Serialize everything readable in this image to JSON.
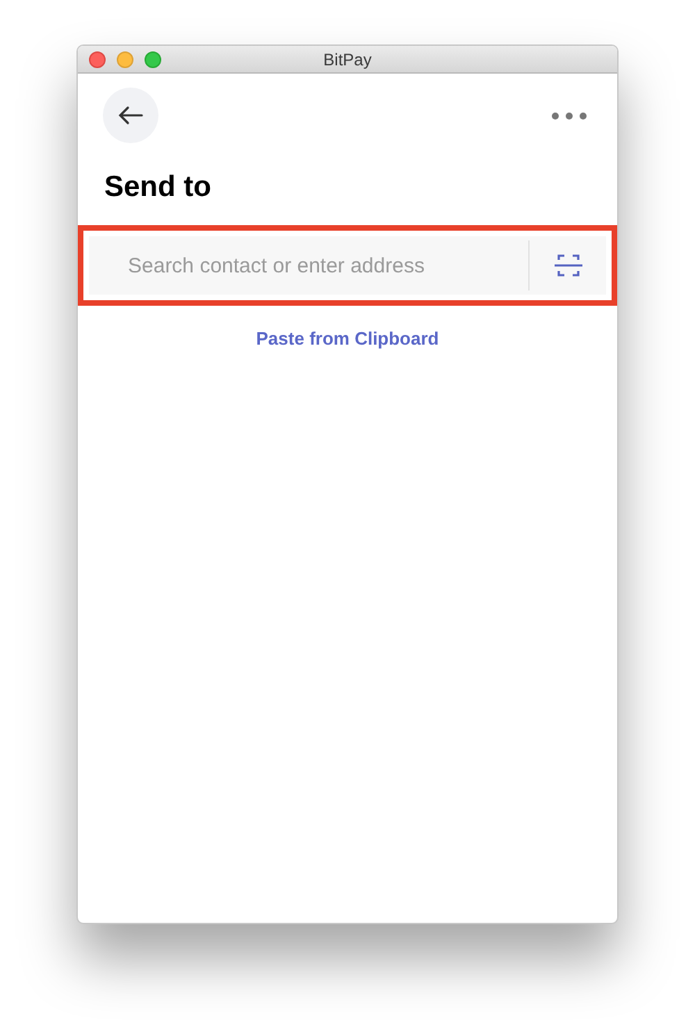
{
  "window": {
    "title": "BitPay"
  },
  "header": {
    "title": "Send to"
  },
  "search": {
    "placeholder": "Search contact or enter address",
    "highlighted": true
  },
  "paste_link": "Paste from Clipboard"
}
